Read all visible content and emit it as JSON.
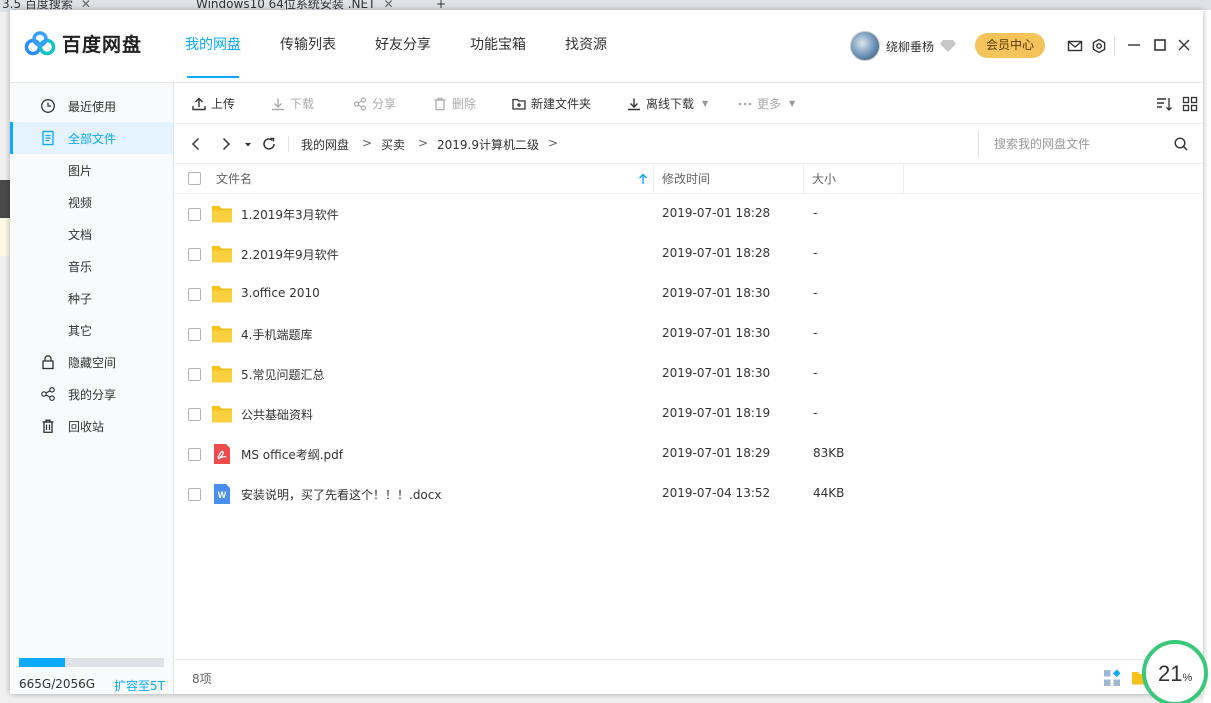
{
  "browser_tabs": [
    {
      "label": "3.5 百度搜索"
    },
    {
      "label": "Windows10 64位系统安装 .NET"
    }
  ],
  "header": {
    "logo_text": "百度网盘",
    "nav": [
      {
        "label": "我的网盘",
        "active": true
      },
      {
        "label": "传输列表",
        "active": false
      },
      {
        "label": "好友分享",
        "active": false
      },
      {
        "label": "功能宝箱",
        "active": false
      },
      {
        "label": "找资源",
        "active": false
      }
    ],
    "username": "绕柳垂杨",
    "vip_label": "会员中心"
  },
  "sidebar": {
    "items": [
      {
        "label": "最近使用",
        "icon": "clock-icon"
      },
      {
        "label": "全部文件",
        "icon": "document-icon",
        "active": true
      },
      {
        "label": "图片"
      },
      {
        "label": "视频"
      },
      {
        "label": "文档"
      },
      {
        "label": "音乐"
      },
      {
        "label": "种子"
      },
      {
        "label": "其它"
      },
      {
        "label": "隐藏空间",
        "icon": "lock-icon"
      },
      {
        "label": "我的分享",
        "icon": "share-icon"
      },
      {
        "label": "回收站",
        "icon": "trash-icon"
      }
    ],
    "quota": {
      "used_fraction": 0.32,
      "text": "665G/2056G",
      "expand_label": "扩容至5T"
    }
  },
  "toolbar": {
    "upload": "上传",
    "download": "下载",
    "share": "分享",
    "delete": "删除",
    "new_folder": "新建文件夹",
    "offline_download": "离线下载",
    "more": "更多"
  },
  "path": {
    "crumbs": [
      "我的网盘",
      "买卖",
      "2019.9计算机二级"
    ],
    "separator": ">",
    "search_placeholder": "搜索我的网盘文件"
  },
  "table": {
    "headers": {
      "name": "文件名",
      "modified": "修改时间",
      "size": "大小"
    },
    "rows": [
      {
        "name": "1.2019年3月软件",
        "modified": "2019-07-01 18:28",
        "size": "-",
        "type": "folder"
      },
      {
        "name": "2.2019年9月软件",
        "modified": "2019-07-01 18:28",
        "size": "-",
        "type": "folder"
      },
      {
        "name": "3.office 2010",
        "modified": "2019-07-01 18:30",
        "size": "-",
        "type": "folder"
      },
      {
        "name": "4.手机端题库",
        "modified": "2019-07-01 18:30",
        "size": "-",
        "type": "folder"
      },
      {
        "name": "5.常见问题汇总",
        "modified": "2019-07-01 18:30",
        "size": "-",
        "type": "folder"
      },
      {
        "name": "公共基础资料",
        "modified": "2019-07-01 18:19",
        "size": "-",
        "type": "folder"
      },
      {
        "name": "MS office考纲.pdf",
        "modified": "2019-07-01 18:29",
        "size": "83KB",
        "type": "pdf"
      },
      {
        "name": "安装说明，买了先看这个！！！.docx",
        "modified": "2019-07-04 13:52",
        "size": "44KB",
        "type": "docx"
      }
    ]
  },
  "footer": {
    "count": "8项"
  },
  "overlay": {
    "percent": "21",
    "unit": "%"
  },
  "colors": {
    "accent": "#09aaff",
    "folder": "#f8c21c",
    "pdf": "#ee4c4c",
    "doc": "#4a8ef0",
    "vip": "#f4c35a"
  }
}
